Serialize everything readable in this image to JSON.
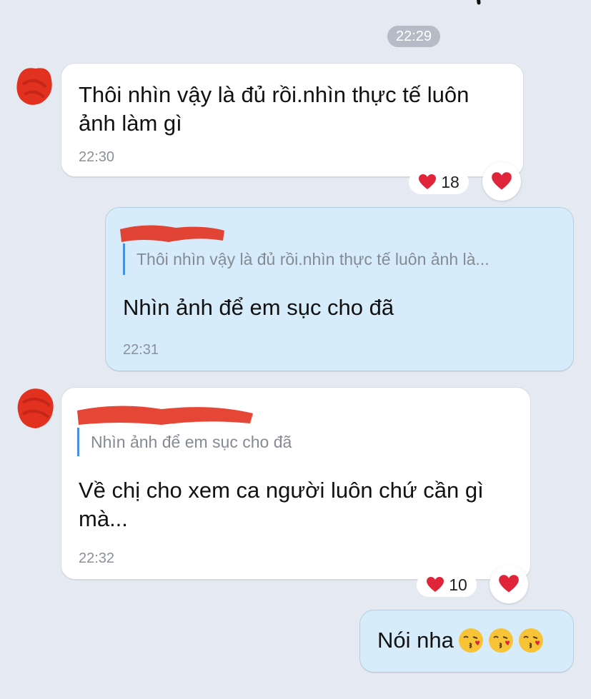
{
  "timestamp_divider": "22:29",
  "messages": [
    {
      "direction": "incoming",
      "text": "Thôi nhìn vậy là đủ rồi.nhìn thực tế luôn ảnh làm gì",
      "line1": "Thôi nhìn vậy là đủ rồi.nhìn thực tế luôn",
      "line2": "ảnh làm gì",
      "time": "22:30",
      "reaction_count": "18",
      "reaction_icon": "heart-icon"
    },
    {
      "direction": "outgoing",
      "quote_text": "Thôi nhìn vậy là đủ rồi.nhìn thực tế luôn ảnh là...",
      "text": "Nhìn ảnh để em sục cho đã",
      "time": "22:31"
    },
    {
      "direction": "incoming",
      "quote_text": "Nhìn ảnh để em sục cho đã",
      "text": "Về chị cho xem ca người luôn chứ cần gì mà...",
      "line1": "Về chị cho xem ca người luôn chứ cần gì",
      "line2": "mà...",
      "time": "22:32",
      "reaction_count": "10",
      "reaction_icon": "heart-icon"
    },
    {
      "direction": "outgoing",
      "text": "Nói nha",
      "emojis": [
        "kissing-heart-emoji",
        "kissing-heart-emoji",
        "kissing-heart-emoji"
      ]
    }
  ],
  "colors": {
    "background": "#e5e9f2",
    "incoming_bubble": "#ffffff",
    "outgoing_bubble": "#d7ecfb",
    "quote_bar": "#4a90e2",
    "heart": "#e0243a",
    "redaction": "#e2321f"
  }
}
